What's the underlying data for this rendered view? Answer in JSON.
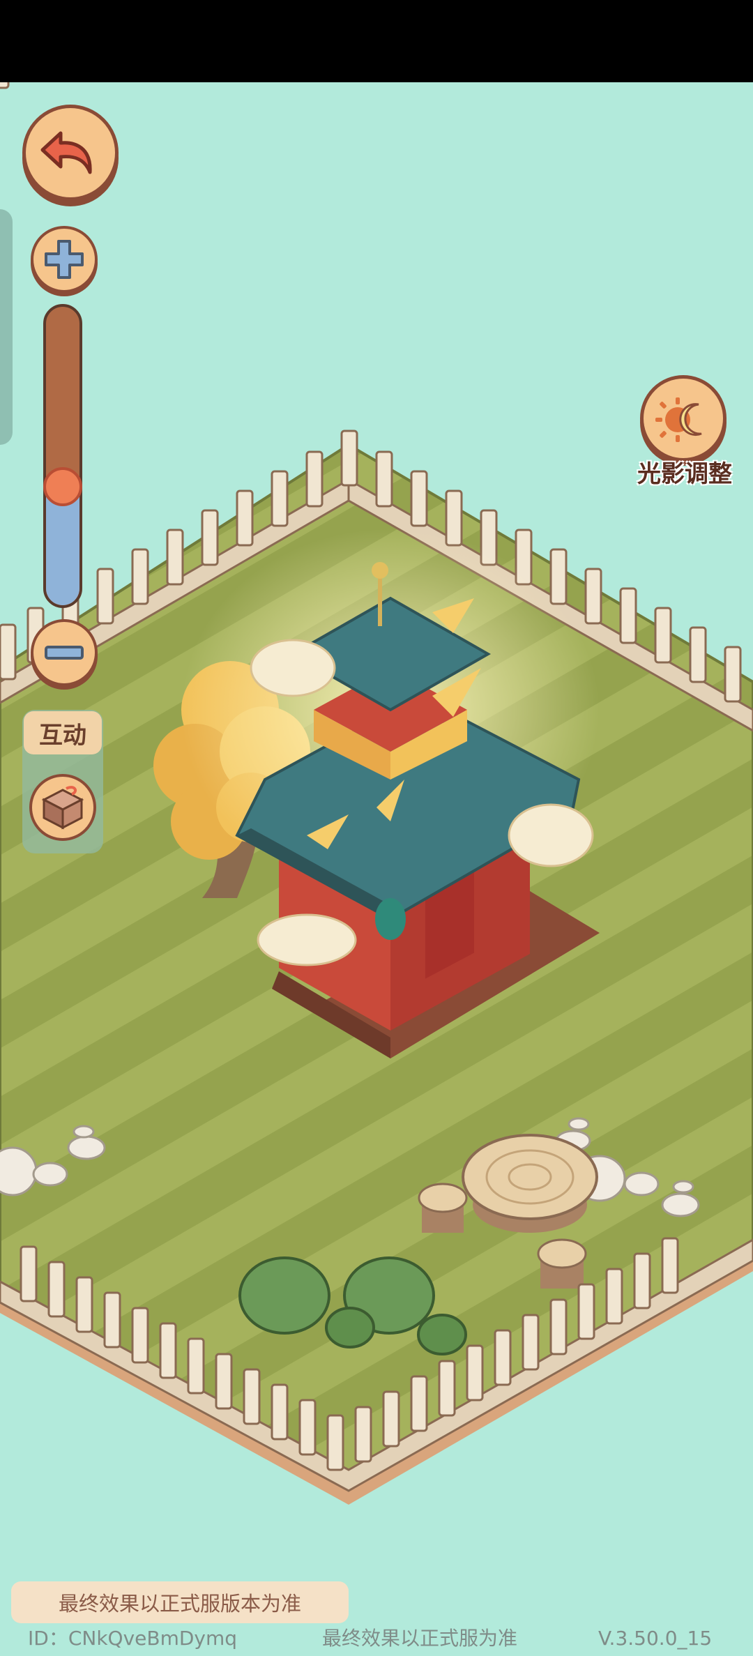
{
  "labels": {
    "interact": "互动",
    "light_adjust": "光影调整",
    "notice": "最终效果以正式服版本为准"
  },
  "footer": {
    "id_text": "ID：CNkQveBmDymq",
    "note": "最终效果以正式服为准",
    "version": "V.3.50.0_15"
  },
  "zoom": {
    "level": 0.4
  },
  "icons": {
    "back": "back-arrow-icon",
    "zoom_in": "plus-icon",
    "zoom_out": "minus-icon",
    "interact": "gift-box-icon",
    "light": "sun-moon-icon"
  },
  "colors": {
    "background": "#b2eadb",
    "grass_dark": "#95a34e",
    "grass_light": "#a5b25c",
    "button_fill": "#f6c58c",
    "button_border": "#8a4b36",
    "accent_red": "#e8634a"
  }
}
